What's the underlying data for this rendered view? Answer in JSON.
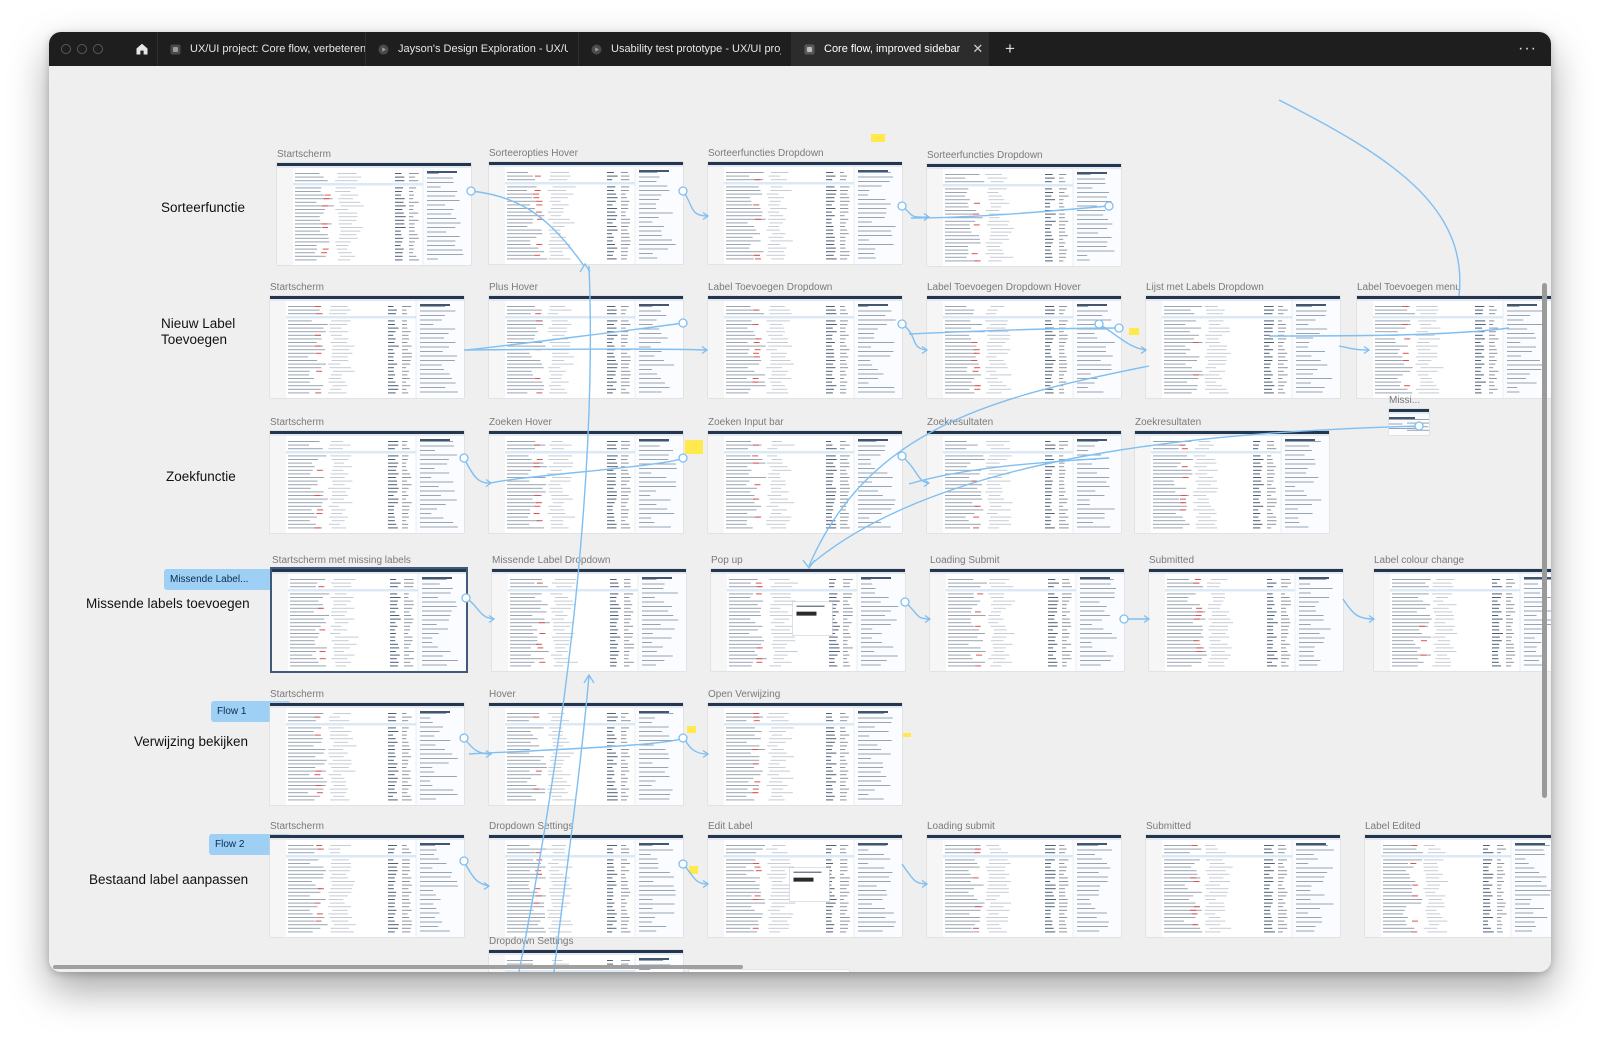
{
  "window": {
    "tabs": [
      {
        "label": "UX/UI project: Core flow, verbeteren",
        "icon": "design-file-icon",
        "active": false
      },
      {
        "label": "Jayson's Design Exploration - UX/UI p",
        "icon": "prototype-play-icon",
        "active": false
      },
      {
        "label": "Usability test prototype - UX/UI proje",
        "icon": "prototype-play-icon",
        "active": false
      },
      {
        "label": "Core flow, improved sidebar",
        "icon": "design-file-icon",
        "active": true
      }
    ],
    "close_glyph": "✕",
    "new_tab_glyph": "+",
    "more_glyph": "···"
  },
  "rows": [
    {
      "label": "Sorteerfunctie"
    },
    {
      "label": "Nieuw Label\nToevoegen"
    },
    {
      "label": "Zoekfunctie"
    },
    {
      "label": "Missende labels toevoegen"
    },
    {
      "label": "Verwijzing bekijken"
    },
    {
      "label": "Bestaand label aanpassen"
    }
  ],
  "flow_tags": [
    {
      "label": "Missende Label..."
    },
    {
      "label": "Flow 1"
    },
    {
      "label": "Flow 2"
    }
  ],
  "frames": [
    {
      "title": "Startscherm"
    },
    {
      "title": "Sorteeropties Hover"
    },
    {
      "title": "Sorteerfuncties Dropdown"
    },
    {
      "title": "Sorteerfuncties Dropdown"
    },
    {
      "title": "Startscherm"
    },
    {
      "title": "Plus Hover"
    },
    {
      "title": "Label Toevoegen Dropdown"
    },
    {
      "title": "Label Toevoegen Dropdown Hover"
    },
    {
      "title": "Lijst met Labels Dropdown"
    },
    {
      "title": "Label Toevoegen menu"
    },
    {
      "title": "Startscherm"
    },
    {
      "title": "Zoeken Hover"
    },
    {
      "title": "Zoeken Input bar"
    },
    {
      "title": "Zoekresultaten"
    },
    {
      "title": "Zoekresultaten"
    },
    {
      "title": "Startscherm met missing labels"
    },
    {
      "title": "Missende Label Dropdown"
    },
    {
      "title": "Pop up"
    },
    {
      "title": "Loading Submit"
    },
    {
      "title": "Submitted"
    },
    {
      "title": "Label colour change"
    },
    {
      "title": "Startscherm"
    },
    {
      "title": "Hover"
    },
    {
      "title": "Open Verwijzing"
    },
    {
      "title": "Startscherm"
    },
    {
      "title": "Dropdown Settings"
    },
    {
      "title": "Edit Label"
    },
    {
      "title": "Loading submit"
    },
    {
      "title": "Submitted"
    },
    {
      "title": "Label Edited"
    },
    {
      "title": "Dropdown Settings"
    },
    {
      "title": "Missi..."
    }
  ],
  "colors": {
    "tabbar": "#1e1e1e",
    "canvas": "#efefef",
    "wire": "#7fbff2",
    "flow_tag": "#9ecff4",
    "sticky": "#ffe94d",
    "mock_header": "#24364f",
    "mock_red": "#d9534f"
  }
}
